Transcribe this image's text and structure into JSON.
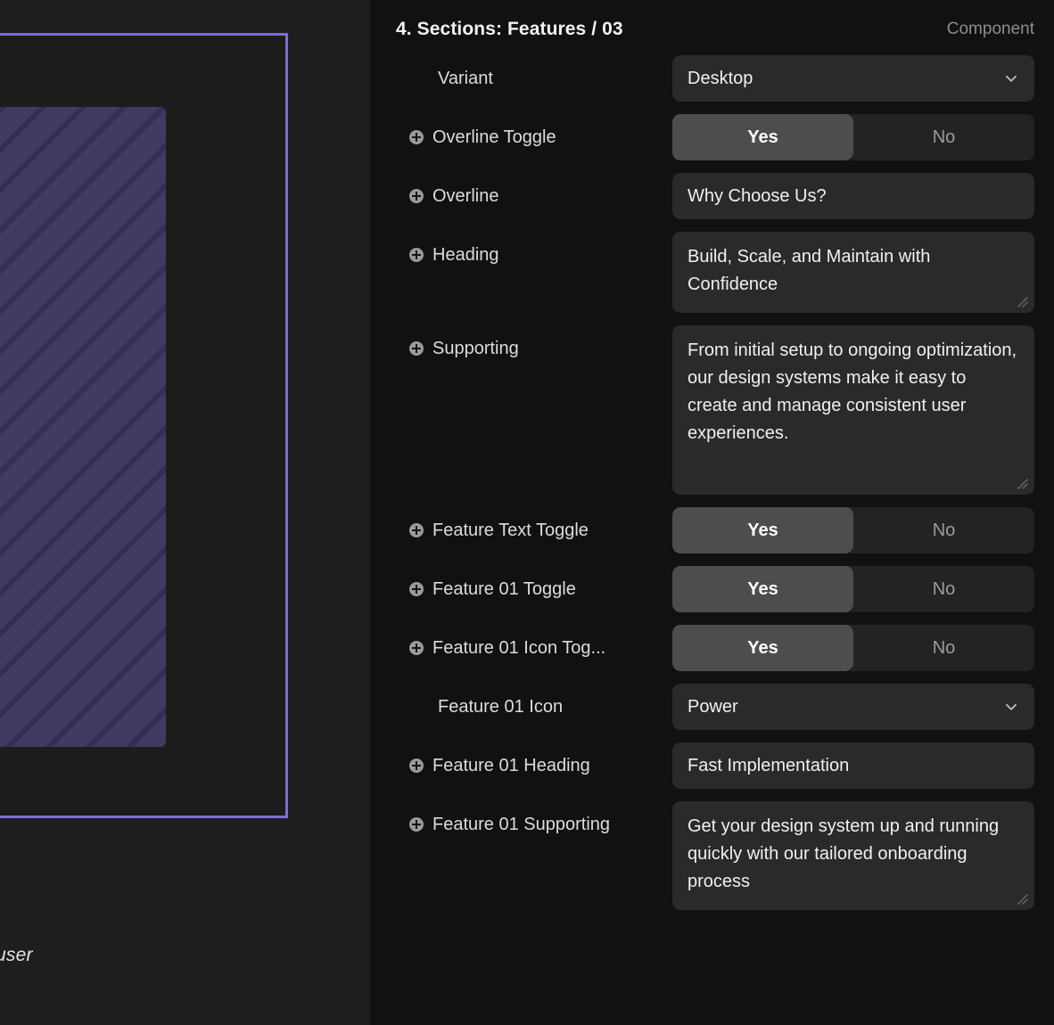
{
  "preview": {
    "caption": "our user",
    "frame_color": "#7c6ce0",
    "placeholder_color": "#413a63",
    "placeholder_stripe_color": "#342d54",
    "background": "#1e1e1e"
  },
  "panel": {
    "background": "#111111",
    "title": "4. Sections: Features / 03",
    "kind": "Component",
    "rows": [
      {
        "label": "Variant",
        "has_plus": false,
        "type": "select",
        "value": "Desktop",
        "icon": "chevron-down-icon",
        "name": "variant"
      },
      {
        "label": "Overline Toggle",
        "has_plus": true,
        "type": "segmented",
        "options": [
          "Yes",
          "No"
        ],
        "selected": "Yes",
        "name": "overline-toggle"
      },
      {
        "label": "Overline",
        "has_plus": true,
        "type": "text",
        "value": "Why Choose Us?",
        "name": "overline"
      },
      {
        "label": "Heading",
        "has_plus": true,
        "type": "textarea",
        "size": "h2",
        "value": "Build, Scale, and Maintain with Confidence",
        "name": "heading"
      },
      {
        "label": "Supporting",
        "has_plus": true,
        "type": "textarea",
        "size": "h5",
        "value": "From initial setup to ongoing optimization, our design systems make it easy to create and manage consistent user experiences.",
        "name": "supporting"
      },
      {
        "label": "Feature Text Toggle",
        "has_plus": true,
        "type": "segmented",
        "options": [
          "Yes",
          "No"
        ],
        "selected": "Yes",
        "name": "feature-text-toggle"
      },
      {
        "label": "Feature 01 Toggle",
        "has_plus": true,
        "type": "segmented",
        "options": [
          "Yes",
          "No"
        ],
        "selected": "Yes",
        "name": "feature-01-toggle"
      },
      {
        "label": "Feature 01 Icon Tog...",
        "has_plus": true,
        "type": "segmented",
        "options": [
          "Yes",
          "No"
        ],
        "selected": "Yes",
        "name": "feature-01-icon-toggle"
      },
      {
        "label": "Feature 01 Icon",
        "has_plus": false,
        "type": "select",
        "value": "Power",
        "icon": "chevron-down-icon",
        "name": "feature-01-icon"
      },
      {
        "label": "Feature 01 Heading",
        "has_plus": true,
        "type": "text",
        "value": "Fast Implementation",
        "name": "feature-01-heading"
      },
      {
        "label": "Feature 01 Supporting",
        "has_plus": true,
        "type": "textarea",
        "size": "hopen",
        "value": "Get your design system up and running quickly with our tailored onboarding process",
        "name": "feature-01-supporting"
      }
    ]
  }
}
